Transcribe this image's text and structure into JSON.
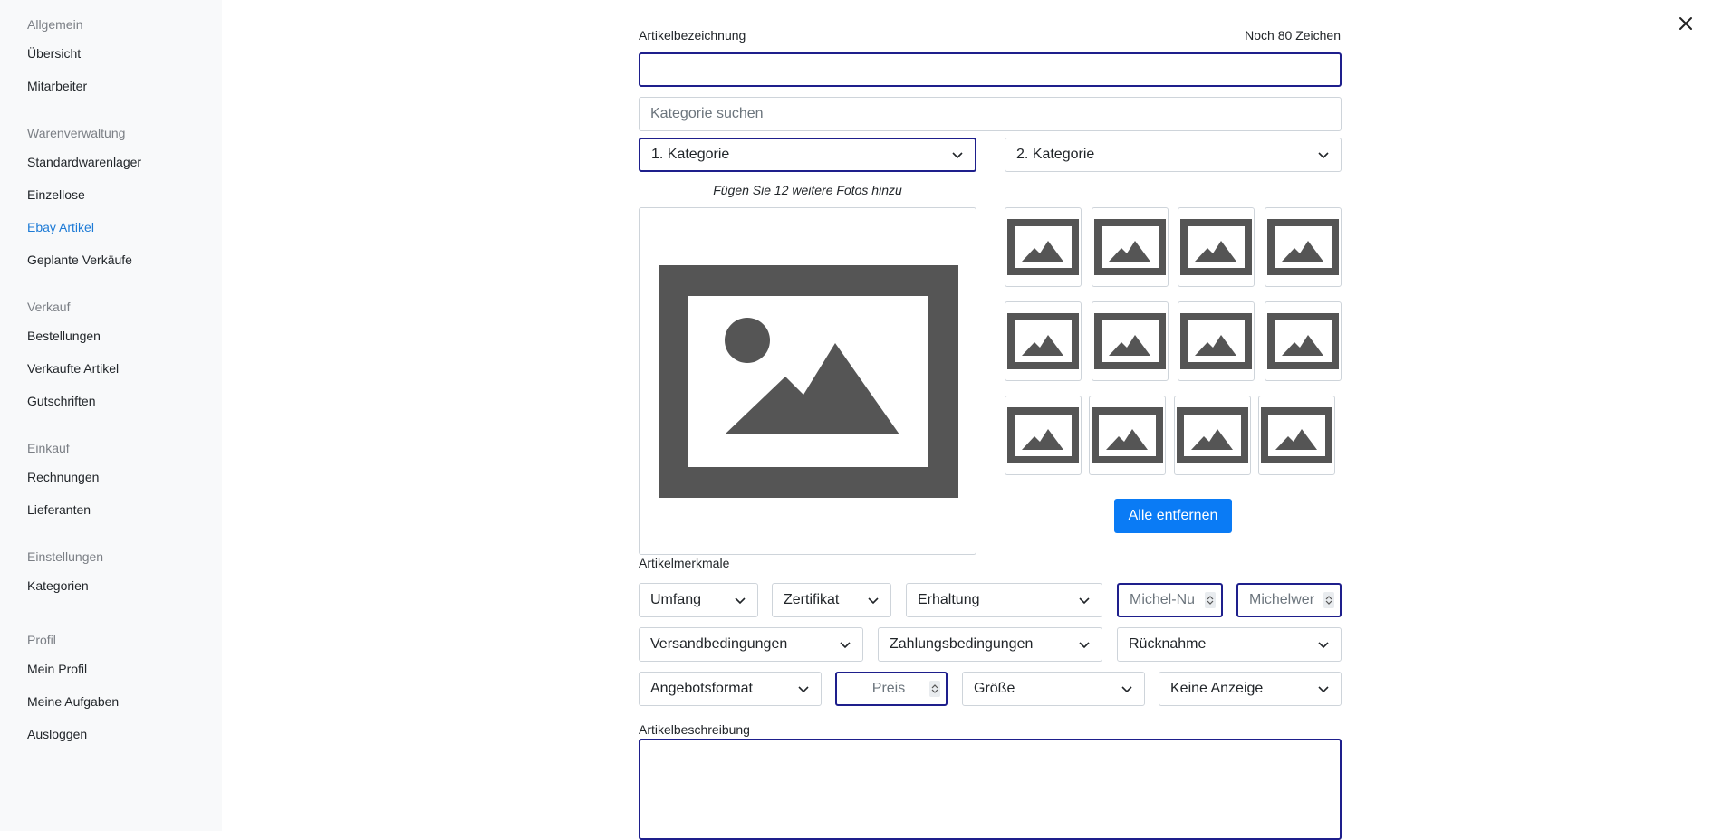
{
  "sidebar": {
    "sections": [
      {
        "title": "Allgemein",
        "items": [
          {
            "label": "Übersicht"
          },
          {
            "label": "Mitarbeiter"
          }
        ]
      },
      {
        "title": "Warenverwaltung",
        "items": [
          {
            "label": "Standardwarenlager"
          },
          {
            "label": "Einzellose"
          },
          {
            "label": "Ebay Artikel",
            "active": true
          },
          {
            "label": "Geplante Verkäufe"
          }
        ]
      },
      {
        "title": "Verkauf",
        "items": [
          {
            "label": "Bestellungen"
          },
          {
            "label": "Verkaufte Artikel"
          },
          {
            "label": "Gutschriften"
          }
        ]
      },
      {
        "title": "Einkauf",
        "items": [
          {
            "label": "Rechnungen"
          },
          {
            "label": "Lieferanten"
          }
        ]
      },
      {
        "title": "Einstellungen",
        "items": [
          {
            "label": "Kategorien"
          }
        ]
      },
      {
        "title": "Profil",
        "items": [
          {
            "label": "Mein Profil"
          },
          {
            "label": "Meine Aufgaben"
          },
          {
            "label": "Ausloggen"
          }
        ]
      }
    ]
  },
  "form": {
    "title_label": "Artikelbezeichnung",
    "title_counter": "Noch 80 Zeichen",
    "title_value": "",
    "category_search_placeholder": "Kategorie suchen",
    "category1": "1. Kategorie",
    "category2": "2. Kategorie",
    "photo_hint": "Fügen Sie 12 weitere Fotos hinzu",
    "remove_all": "Alle entfernen",
    "features_label": "Artikelmerkmale",
    "umfang": "Umfang",
    "zertifikat": "Zertifikat",
    "erhaltung": "Erhaltung",
    "michel_nummer_placeholder": "Michel-Nu",
    "michelwert_placeholder": "Michelwer",
    "versandbedingungen": "Versandbedingungen",
    "zahlungsbedingungen": "Zahlungsbedingungen",
    "ruecknahme": "Rücknahme",
    "angebotsformat": "Angebotsformat",
    "preis_placeholder": "Preis",
    "groesse": "Größe",
    "anzeige": "Keine Anzeige",
    "description_label": "Artikelbeschreibung",
    "description_value": ""
  },
  "icons": {
    "close": "close-icon",
    "chevron": "chevron-down-icon",
    "photo": "image-placeholder-icon",
    "spinner": "spinner-arrows-icon"
  },
  "colors": {
    "accent": "#0a7bf5",
    "active_nav": "#1e7bd6",
    "focus_border": "#1e1f8c",
    "placeholder_icon": "#555555"
  }
}
